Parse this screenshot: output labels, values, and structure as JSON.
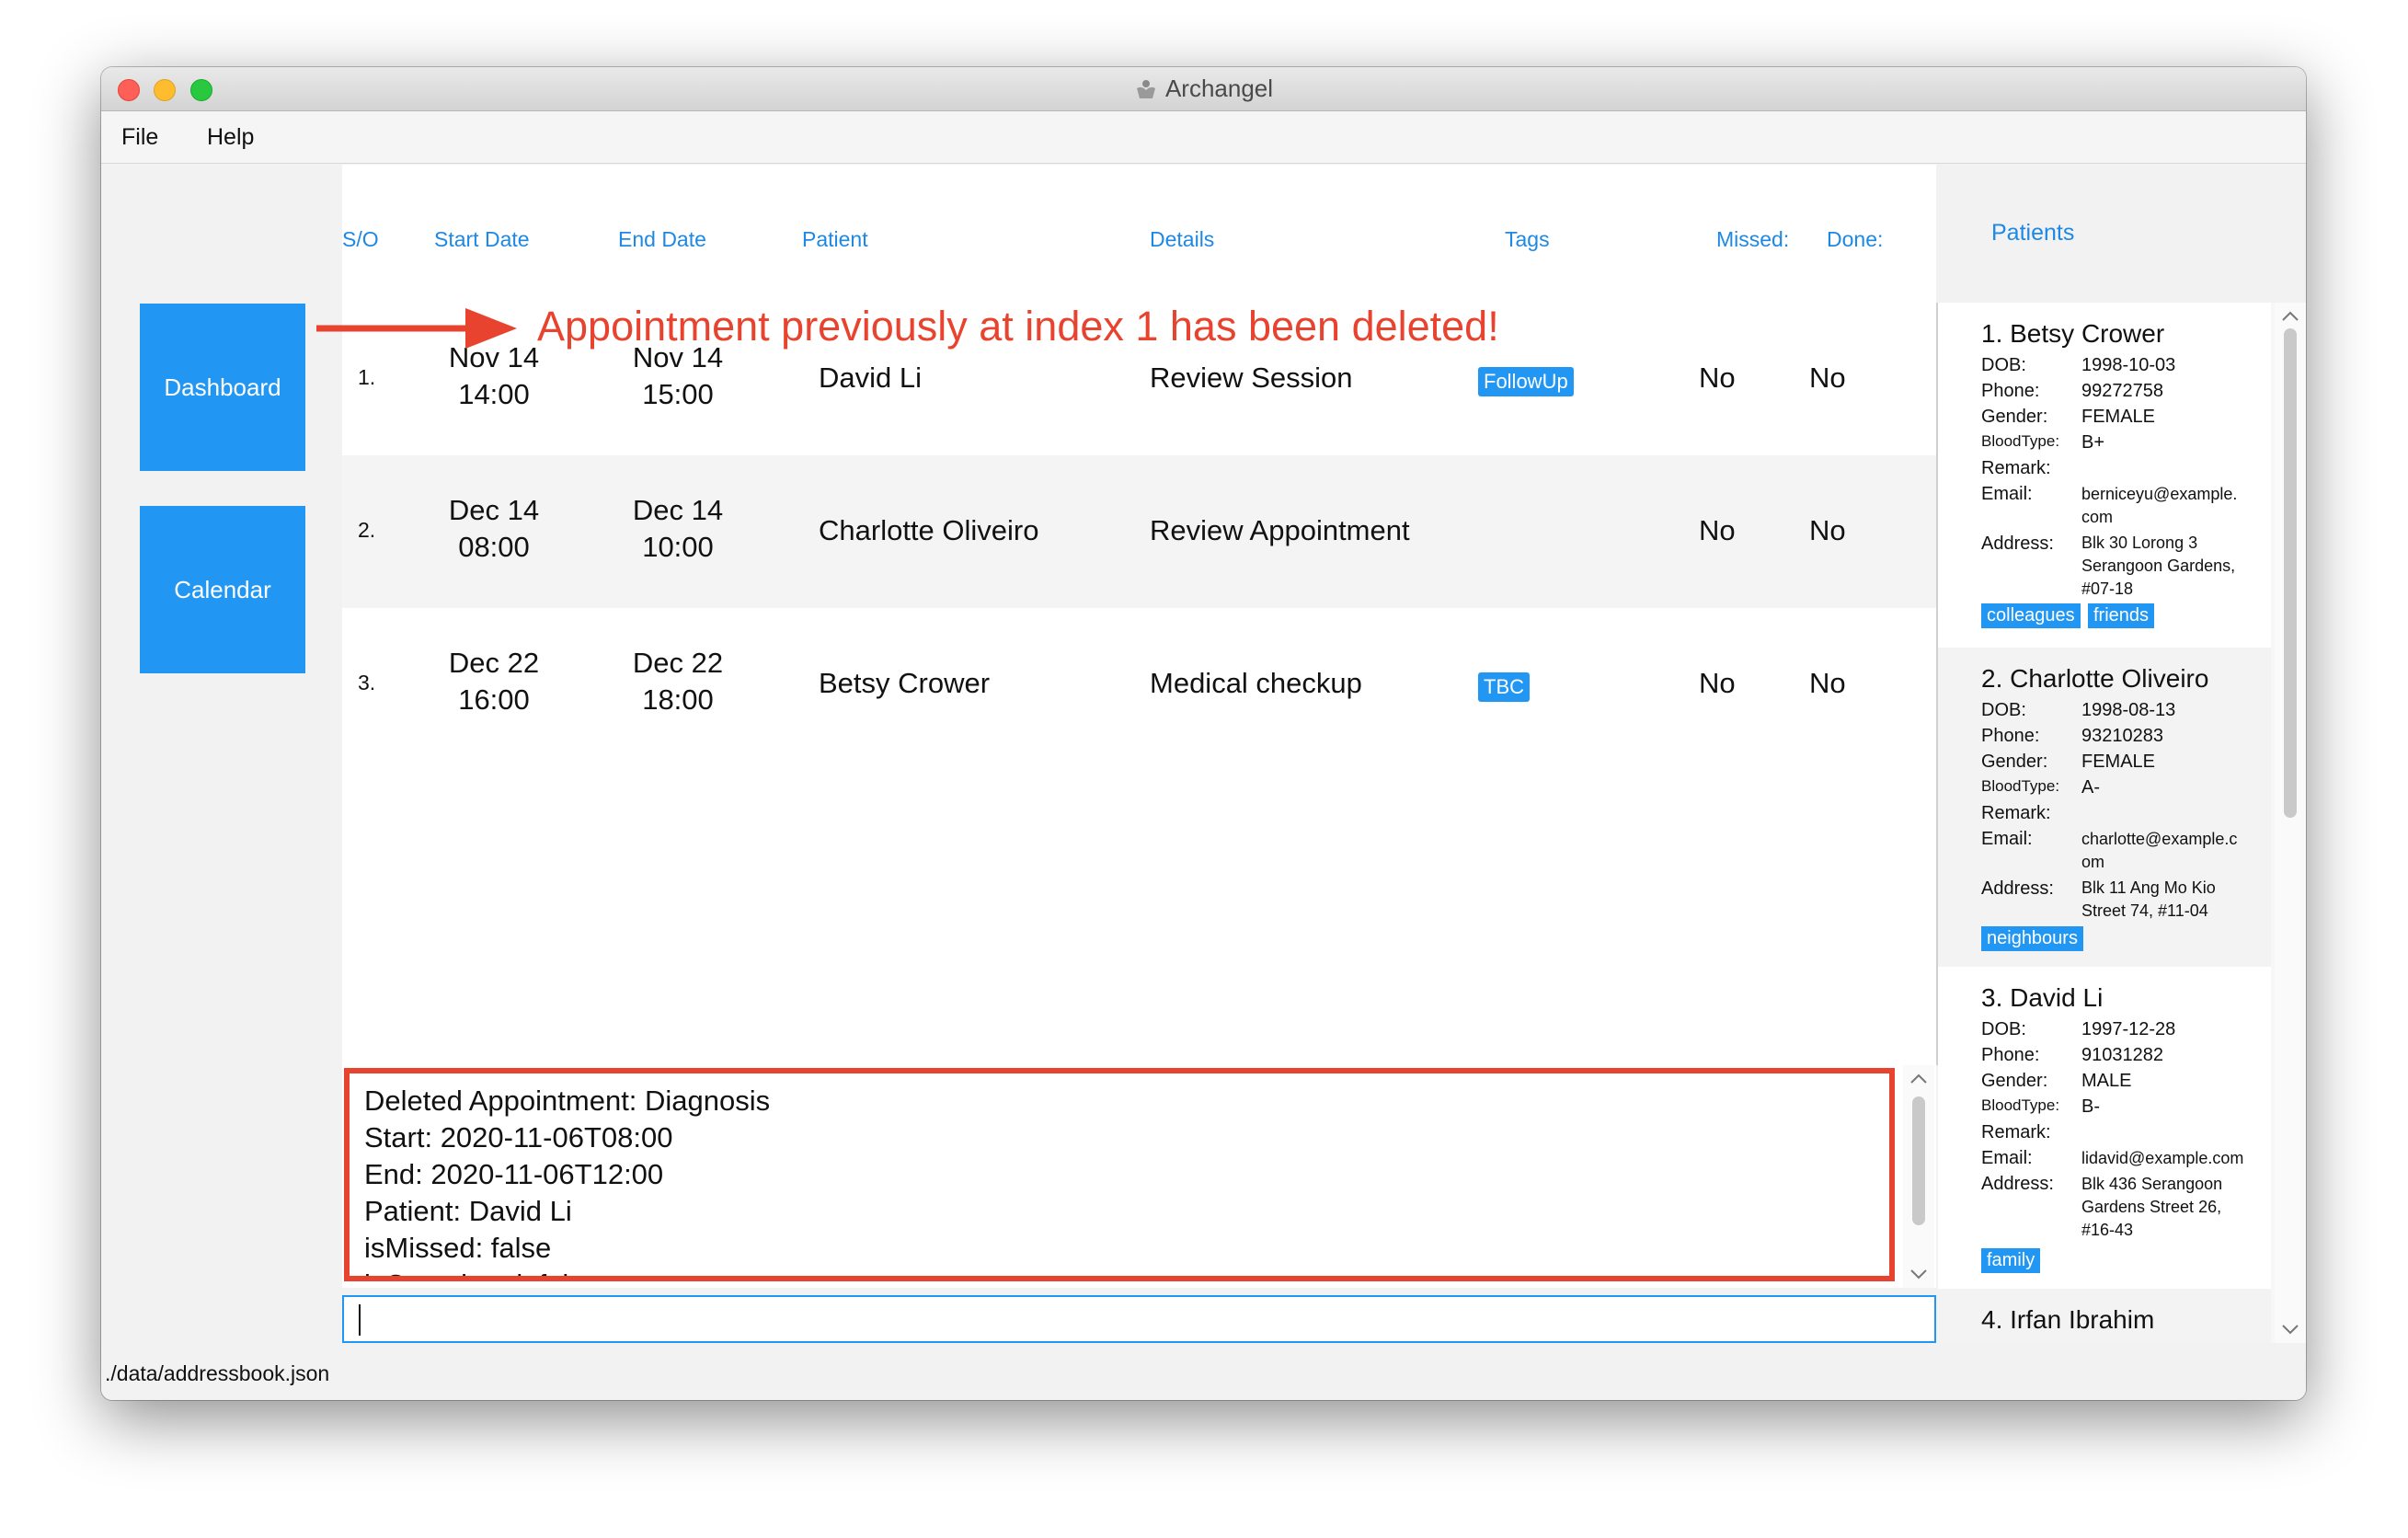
{
  "window": {
    "title": "Archangel"
  },
  "menu": [
    "File",
    "Help"
  ],
  "nav": {
    "dashboard": "Dashboard",
    "calendar": "Calendar"
  },
  "headers": {
    "so": "S/O",
    "start": "Start Date",
    "end": "End Date",
    "patient": "Patient",
    "details": "Details",
    "tags": "Tags",
    "missed": "Missed:",
    "done": "Done:"
  },
  "feedback": "Appointment previously at index 1 has been deleted!",
  "appointments": [
    {
      "index": "1.",
      "start_date": "Nov 14",
      "start_time": "14:00",
      "end_date": "Nov 14",
      "end_time": "15:00",
      "patient": "David Li",
      "details": "Review Session",
      "tag": "FollowUp",
      "missed": "No",
      "done": "No"
    },
    {
      "index": "2.",
      "start_date": "Dec 14",
      "start_time": "08:00",
      "end_date": "Dec 14",
      "end_time": "10:00",
      "patient": "Charlotte Oliveiro",
      "details": "Review Appointment",
      "tag": "",
      "missed": "No",
      "done": "No"
    },
    {
      "index": "3.",
      "start_date": "Dec 22",
      "start_time": "16:00",
      "end_date": "Dec 22",
      "end_time": "18:00",
      "patient": "Betsy Crower",
      "details": "Medical checkup",
      "tag": "TBC",
      "missed": "No",
      "done": "No"
    }
  ],
  "result_lines": [
    "Deleted Appointment: Diagnosis",
    "Start: 2020-11-06T08:00",
    "End: 2020-11-06T12:00",
    "Patient: David Li",
    "isMissed: false",
    "isCompleted: false"
  ],
  "command": {
    "value": ""
  },
  "patients_title": "Patients",
  "field_labels": {
    "dob": "DOB:",
    "phone": "Phone:",
    "gender": "Gender:",
    "bloodtype": "BloodType:",
    "remark": "Remark:",
    "email": "Email:",
    "address": "Address:"
  },
  "patients": [
    {
      "name": "1. Betsy Crower",
      "dob": "1998-10-03",
      "phone": "99272758",
      "gender": "FEMALE",
      "bloodtype": "B+",
      "remark": "",
      "email": [
        "berniceyu@example.",
        "com"
      ],
      "address": [
        "Blk 30 Lorong 3",
        "Serangoon Gardens,",
        "#07-18"
      ],
      "tags": [
        "colleagues",
        "friends"
      ]
    },
    {
      "name": "2. Charlotte Oliveiro",
      "dob": "1998-08-13",
      "phone": "93210283",
      "gender": "FEMALE",
      "bloodtype": "A-",
      "remark": "",
      "email": [
        "charlotte@example.c",
        "om"
      ],
      "address": [
        "Blk 11 Ang Mo Kio",
        "Street 74, #11-04"
      ],
      "tags": [
        "neighbours"
      ]
    },
    {
      "name": "3. David Li",
      "dob": "1997-12-28",
      "phone": "91031282",
      "gender": "MALE",
      "bloodtype": "B-",
      "remark": "",
      "email": [
        "lidavid@example.com"
      ],
      "address": [
        "Blk 436 Serangoon",
        "Gardens Street 26,",
        "#16-43"
      ],
      "tags": [
        "family"
      ]
    },
    {
      "name": "4. Irfan Ibrahim"
    }
  ],
  "status": "./data/addressbook.json"
}
